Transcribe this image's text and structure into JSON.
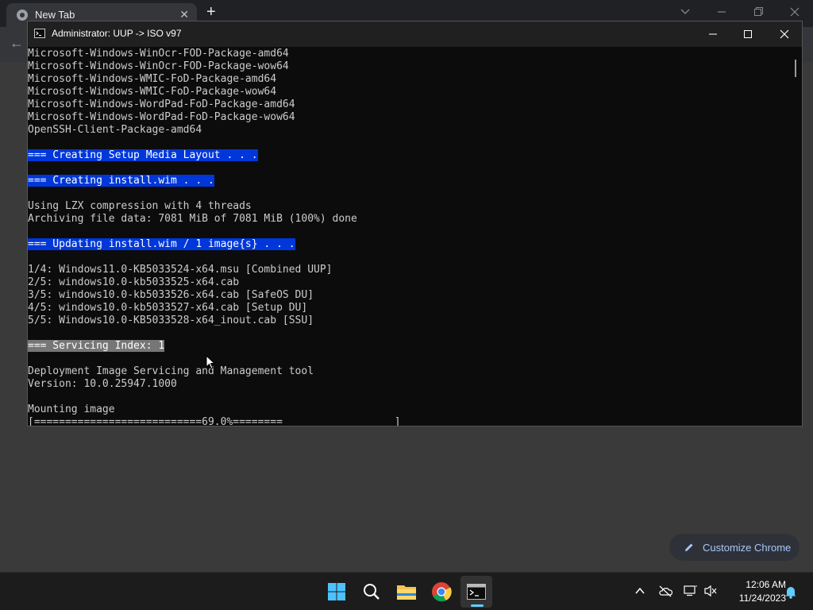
{
  "chrome": {
    "tab_title": "New Tab",
    "close_glyph": "✕",
    "newtab_glyph": "+",
    "back_glyph": "←",
    "customize_label": "Customize Chrome"
  },
  "console": {
    "title": "Administrator:  UUP -> ISO v97",
    "lines": [
      {
        "text": "Microsoft-Windows-WinOcr-FOD-Package-amd64",
        "style": "plain"
      },
      {
        "text": "Microsoft-Windows-WinOcr-FOD-Package-wow64",
        "style": "plain"
      },
      {
        "text": "Microsoft-Windows-WMIC-FoD-Package-amd64",
        "style": "plain"
      },
      {
        "text": "Microsoft-Windows-WMIC-FoD-Package-wow64",
        "style": "plain"
      },
      {
        "text": "Microsoft-Windows-WordPad-FoD-Package-amd64",
        "style": "plain"
      },
      {
        "text": "Microsoft-Windows-WordPad-FoD-Package-wow64",
        "style": "plain"
      },
      {
        "text": "OpenSSH-Client-Package-amd64",
        "style": "plain"
      },
      {
        "text": "",
        "style": "plain"
      },
      {
        "text": "=== Creating Setup Media Layout . . .",
        "style": "blue"
      },
      {
        "text": "",
        "style": "plain"
      },
      {
        "text": "=== Creating install.wim . . .",
        "style": "blue"
      },
      {
        "text": "",
        "style": "plain"
      },
      {
        "text": "Using LZX compression with 4 threads",
        "style": "plain"
      },
      {
        "text": "Archiving file data: 7081 MiB of 7081 MiB (100%) done",
        "style": "plain"
      },
      {
        "text": "",
        "style": "plain"
      },
      {
        "text": "=== Updating install.wim / 1 image{s} . . .",
        "style": "blue"
      },
      {
        "text": "",
        "style": "plain"
      },
      {
        "text": "1/4: Windows11.0-KB5033524-x64.msu [Combined UUP]",
        "style": "plain"
      },
      {
        "text": "2/5: windows10.0-kb5033525-x64.cab",
        "style": "plain"
      },
      {
        "text": "3/5: windows10.0-kb5033526-x64.cab [SafeOS DU]",
        "style": "plain"
      },
      {
        "text": "4/5: windows10.0-kb5033527-x64.cab [Setup DU]",
        "style": "plain"
      },
      {
        "text": "5/5: Windows10.0-KB5033528-x64_inout.cab [SSU]",
        "style": "plain"
      },
      {
        "text": "",
        "style": "plain"
      },
      {
        "text": "=== Servicing Index: 1",
        "style": "gray"
      },
      {
        "text": "",
        "style": "plain"
      },
      {
        "text": "Deployment Image Servicing and Management tool",
        "style": "plain"
      },
      {
        "text": "Version: 10.0.25947.1000",
        "style": "plain"
      },
      {
        "text": "",
        "style": "plain"
      },
      {
        "text": "Mounting image",
        "style": "plain"
      },
      {
        "text": "[===========================69.0%========                  ]",
        "style": "plain"
      }
    ]
  },
  "taskbar": {
    "apps": [
      "start-icon",
      "search-icon",
      "file-explorer-icon",
      "chrome-icon",
      "terminal-icon"
    ],
    "time": "12:06 AM",
    "date": "11/24/2023"
  }
}
